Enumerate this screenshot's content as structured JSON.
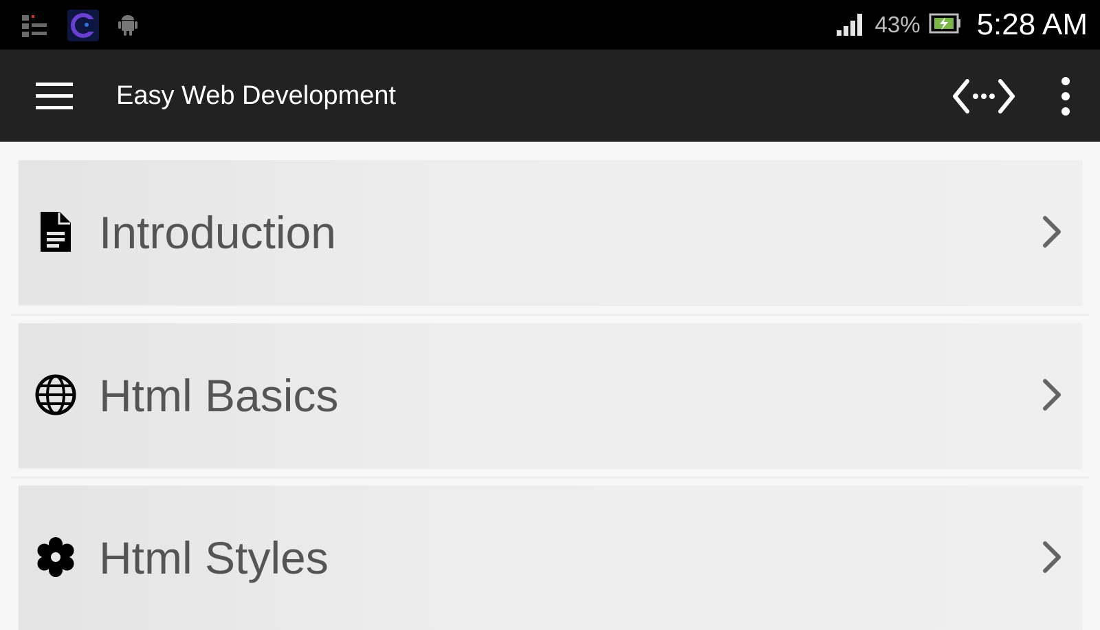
{
  "status_bar": {
    "notification_icons": [
      "task-list-icon",
      "app-logo-icon",
      "android-icon"
    ],
    "battery_percent": "43%",
    "time": "5:28 AM"
  },
  "app_bar": {
    "title": "Easy Web Development",
    "menu_icon": "hamburger-menu-icon",
    "action_icon": "code-icon",
    "overflow_icon": "more-vert-icon"
  },
  "list": {
    "items": [
      {
        "label": "Introduction",
        "icon": "document-icon"
      },
      {
        "label": "Html Basics",
        "icon": "globe-icon"
      },
      {
        "label": "Html Styles",
        "icon": "flower-icon"
      }
    ]
  },
  "colors": {
    "status_bar": "#000000",
    "app_bar": "#222222",
    "card": "#ededed",
    "label": "#555555"
  }
}
